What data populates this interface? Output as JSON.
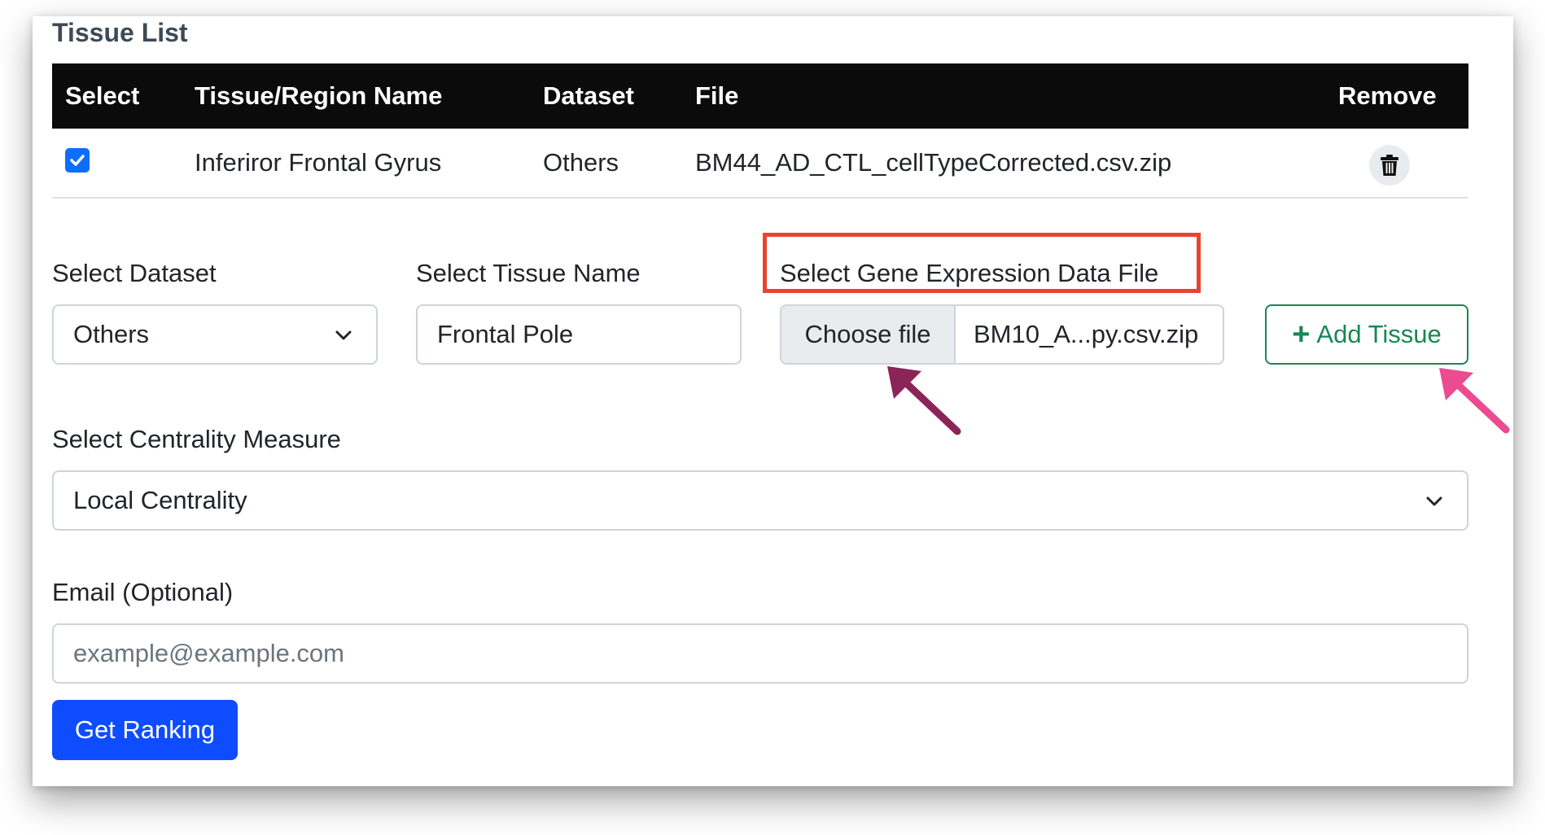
{
  "section_title": "Tissue List",
  "table": {
    "headers": [
      "Select",
      "Tissue/Region Name",
      "Dataset",
      "File",
      "Remove"
    ],
    "rows": [
      {
        "checked": true,
        "name": "Inferiror Frontal Gyrus",
        "dataset": "Others",
        "file": "BM44_AD_CTL_cellTypeCorrected.csv.zip"
      }
    ]
  },
  "form": {
    "dataset_label": "Select Dataset",
    "dataset_value": "Others",
    "tissue_label": "Select Tissue Name",
    "tissue_value": "Frontal Pole",
    "file_label": "Select Gene Expression Data File",
    "file_button": "Choose file",
    "file_name": "BM10_A...py.csv.zip",
    "add_button": "Add Tissue",
    "centrality_label": "Select Centrality Measure",
    "centrality_value": "Local Centrality",
    "email_label": "Email (Optional)",
    "email_placeholder": "example@example.com",
    "submit_button": "Get Ranking"
  },
  "icons": {
    "checkbox": "checkbox-checked-icon",
    "remove": "trash-icon",
    "dropdown": "chevron-down-icon",
    "add": "plus-icon"
  },
  "colors": {
    "header_bg": "#0b0b0b",
    "primary": "#0d4dff",
    "success": "#198754",
    "highlight_box": "#e8442e",
    "arrow_dark": "#8b2457",
    "arrow_pink": "#ec4b8f"
  }
}
